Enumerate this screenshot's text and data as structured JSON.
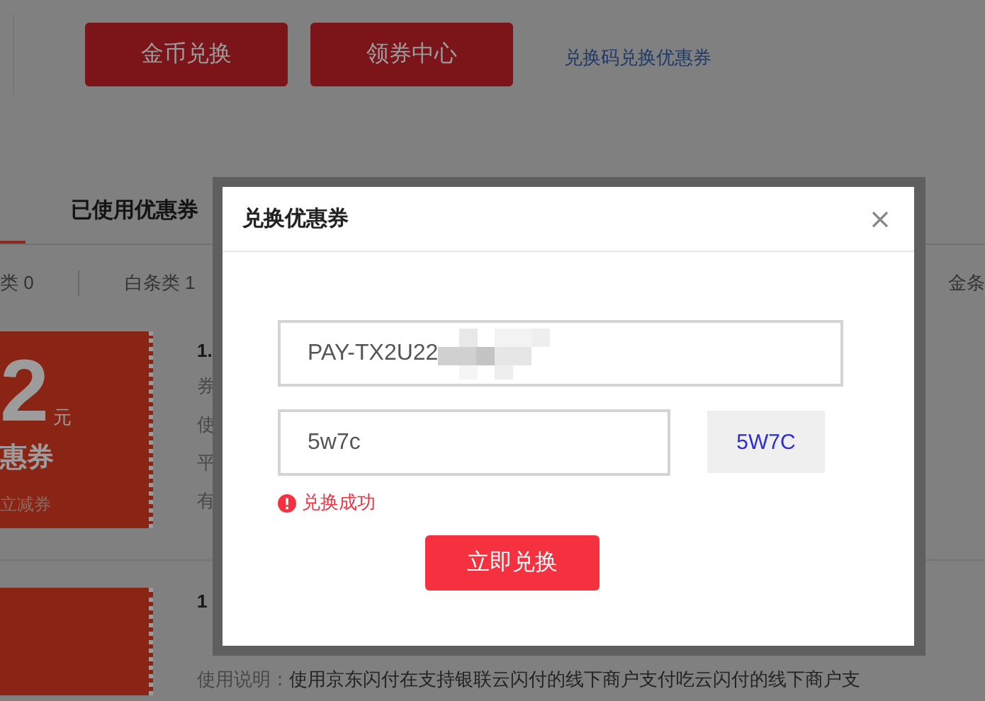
{
  "header_buttons": [
    {
      "label": "金币兑换"
    },
    {
      "label": "领券中心"
    }
  ],
  "redeem_link": "兑换码兑换优惠券",
  "tabs": [
    {
      "selected": true
    },
    {
      "label": "已使用优惠券",
      "selected": false
    }
  ],
  "categories": [
    "类 0",
    "白条类 1",
    "金条"
  ],
  "coupons": [
    {
      "amount": "2",
      "unit": "元",
      "name": "惠券",
      "type": "立减券",
      "title": "1.",
      "lines": [
        "券",
        "使",
        "平",
        "有"
      ]
    },
    {
      "title": "1",
      "desc_label": "使用说明：",
      "desc": "使用京东闪付在支持银联云闪付的线下商户支付吃云闪付的线下商户支"
    }
  ],
  "dialog": {
    "title": "兑换优惠券",
    "code_value": "PAY-TX2U22",
    "code_redacted": true,
    "captcha_value": "5w7c",
    "captcha": "5W7C",
    "message": "兑换成功",
    "submit": "立即兑换"
  }
}
